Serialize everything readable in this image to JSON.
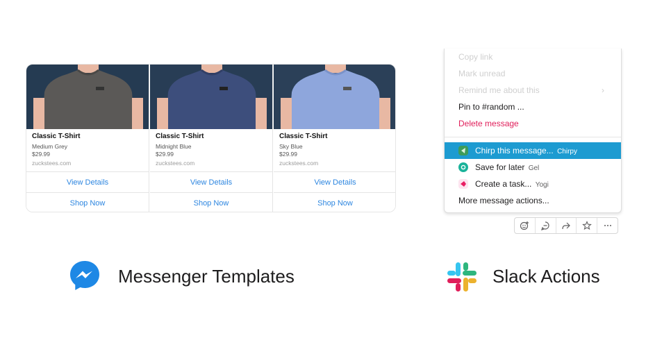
{
  "messenger": {
    "products": [
      {
        "title": "Classic T-Shirt",
        "color_name": "Medium Grey",
        "price": "$29.99",
        "domain": "zuckstees.com",
        "shirt_color": "#5b5957",
        "bg_color": "#263a4f",
        "view_label": "View Details",
        "shop_label": "Shop Now"
      },
      {
        "title": "Classic T-Shirt",
        "color_name": "Midnight Blue",
        "price": "$29.99",
        "domain": "zuckstees.com",
        "shirt_color": "#3d4e7c",
        "bg_color": "#293d54",
        "view_label": "View Details",
        "shop_label": "Shop Now"
      },
      {
        "title": "Classic T-Shirt",
        "color_name": "Sky Blue",
        "price": "$29.99",
        "domain": "zuckstees.com",
        "shirt_color": "#8ea6dc",
        "bg_color": "#2b4058",
        "view_label": "View Details",
        "shop_label": "Shop Now"
      }
    ],
    "caption": "Messenger Templates",
    "brand_color": "#1e88e5"
  },
  "slack": {
    "menu": {
      "copy_link": "Copy link",
      "mark_unread": "Mark unread",
      "remind": "Remind me about this",
      "remind_chevron": "›",
      "pin": "Pin to #random ...",
      "delete": "Delete message",
      "chirp": {
        "label": "Chirp this message...",
        "app": "Chirpy"
      },
      "save": {
        "label": "Save for later",
        "app": "Gel"
      },
      "task": {
        "label": "Create a task...",
        "app": "Yogi"
      },
      "more": "More message actions..."
    },
    "toolbar": [
      "add-reaction-icon",
      "reply-in-thread-icon",
      "share-icon",
      "star-icon",
      "more-icon"
    ],
    "caption": "Slack Actions",
    "highlight_color": "#1d9bd1",
    "danger_color": "#e01e5a"
  }
}
